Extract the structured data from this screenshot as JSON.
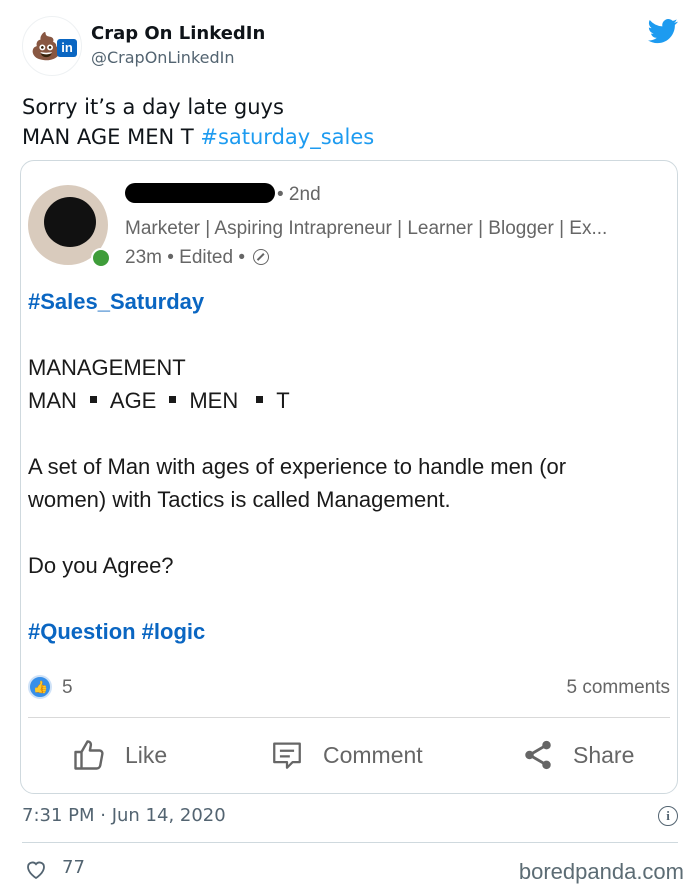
{
  "tweet": {
    "author_name": "Crap On LinkedIn",
    "author_handle": "@CrapOnLinkedIn",
    "avatar_icons": [
      "poop-emoji-icon",
      "linkedin-icon"
    ],
    "text_line1": "Sorry it’s a day late guys",
    "text_line2_prefix": "MAN AGE MEN T ",
    "hashtag": "#saturday_sales",
    "timestamp": "7:31 PM · Jun 14, 2020",
    "like_count": "77",
    "accent_color": "#1d9bf0"
  },
  "linkedin_post": {
    "connection_degree": "• 2nd",
    "headline": "Marketer | Aspiring Intrapreneur | Learner | Blogger | Ex...",
    "meta": "23m • Edited •",
    "hashtag_top": "#Sales_Saturday",
    "title": "MANAGEMENT",
    "split_word": [
      "MAN",
      "AGE",
      "MEN",
      "T"
    ],
    "body_line1": "A set of Man with ages of experience to handle men (or",
    "body_line2": "women) with Tactics is called Management.",
    "question": "Do you Agree?",
    "hashtags_bottom": "#Question #logic",
    "reaction_count": "5",
    "comments_count": "5 comments",
    "actions": {
      "like": "Like",
      "comment": "Comment",
      "share": "Share"
    },
    "brand_color": "#0a66c2"
  },
  "watermark": "boredpanda.com"
}
